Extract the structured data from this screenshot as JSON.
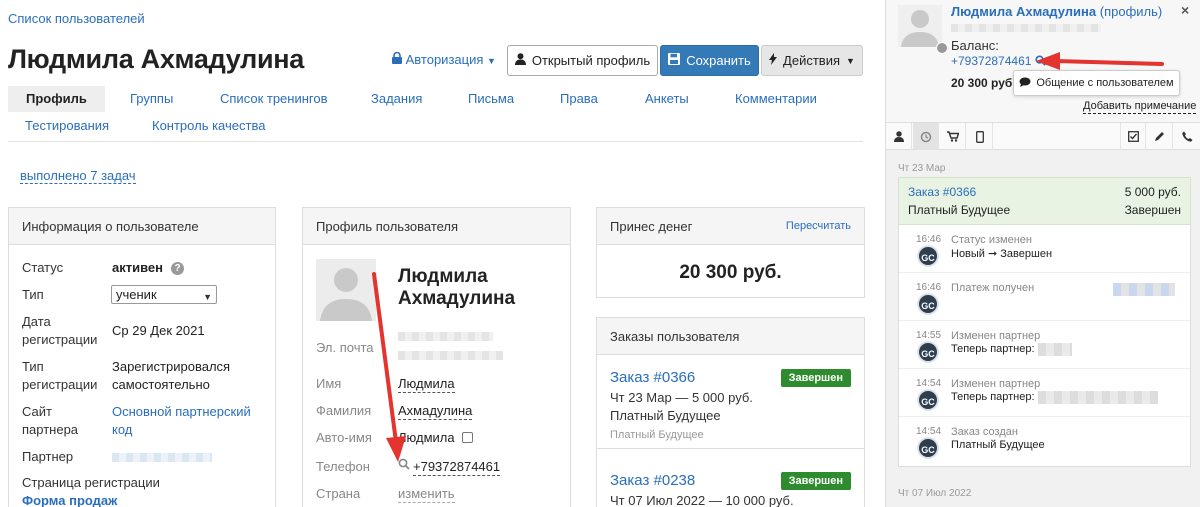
{
  "breadcrumb": "Список пользователей",
  "user_title": "Людмила Ахмадулина",
  "header": {
    "auth_label": "Авторизация",
    "open_profile": "Открытый профиль",
    "save": "Сохранить",
    "actions": "Действия"
  },
  "tabs": [
    "Профиль",
    "Группы",
    "Список тренингов",
    "Задания",
    "Письма",
    "Права",
    "Анкеты",
    "Комментарии",
    "Тестирования",
    "Контроль качества"
  ],
  "tasks_link": "выполнено 7 задач",
  "info": {
    "title": "Информация о пользователе",
    "status_label": "Статус",
    "status_value": "активен",
    "type_label": "Тип",
    "type_value": "ученик",
    "reg_date_label1": "Дата",
    "reg_date_label2": "регистрации",
    "reg_date_value": "Ср 29 Дек 2021",
    "reg_type_label1": "Тип",
    "reg_type_label2": "регистрации",
    "reg_type_value1": "Зарегистрировался",
    "reg_type_value2": "самостоятельно",
    "site_label1": "Сайт",
    "site_label2": "партнера",
    "site_value1": "Основной партнерский",
    "site_value2": "код",
    "partner_label": "Партнер",
    "reg_page_label": "Страница регистрации",
    "reg_page_value": "Форма продаж"
  },
  "profile": {
    "title": "Профиль пользователя",
    "name1": "Людмила",
    "name2": "Ахмадулина",
    "email_label": "Эл. почта",
    "first_name_label": "Имя",
    "first_name": "Людмила",
    "last_name_label": "Фамилия",
    "last_name": "Ахмадулина",
    "auto_name_label": "Авто-имя",
    "auto_name": "Людмила",
    "phone_label": "Телефон",
    "phone": "+79372874461",
    "country_label": "Страна",
    "country_value": "изменить"
  },
  "money": {
    "title": "Принес денег",
    "recalc": "Пересчитать",
    "value": "20 300 руб."
  },
  "orders": {
    "title": "Заказы пользователя",
    "items": [
      {
        "title": "Заказ #0366",
        "status": "Завершен",
        "line1": "Чт 23 Мар — 5 000 руб.",
        "line2": "Платный Будущее",
        "small": "Платный Будущее"
      },
      {
        "title": "Заказ #0238",
        "status": "Завершен",
        "line1": "Чт 07 Июл 2022 — 10 000 руб."
      }
    ]
  },
  "side": {
    "name": "Людмила Ахмадулина",
    "profile_link": "(профиль)",
    "balance_label": "Баланс:",
    "phone": "+79372874461",
    "balance": "20 300 руб.",
    "chat_button": "Общение с пользователем",
    "add_note": "Добавить примечание",
    "date1": "Чт 23 Мар",
    "date2": "Чт 07 Июл 2022",
    "order": {
      "title": "Заказ #0366",
      "amount": "5 000 руб.",
      "product": "Платный Будущее",
      "status": "Завершен"
    },
    "events": [
      {
        "time": "16:46",
        "title": "Статус изменен",
        "text": "Новый ➞ Завершен"
      },
      {
        "time": "16:46",
        "title": "Платеж получен",
        "text": ""
      },
      {
        "time": "14:55",
        "title": "Изменен партнер",
        "text": "Теперь партнер:"
      },
      {
        "time": "14:54",
        "title": "Изменен партнер",
        "text": "Теперь партнер:"
      },
      {
        "time": "14:54",
        "title": "Заказ создан",
        "text": "Платный Будущее"
      }
    ],
    "gc": "GC"
  },
  "colors": {
    "link": "#2a6ebb",
    "save": "#337ab7",
    "badge": "#2e8b2e",
    "arrow": "#e3342f",
    "order_bg": "#e8f3e3"
  }
}
